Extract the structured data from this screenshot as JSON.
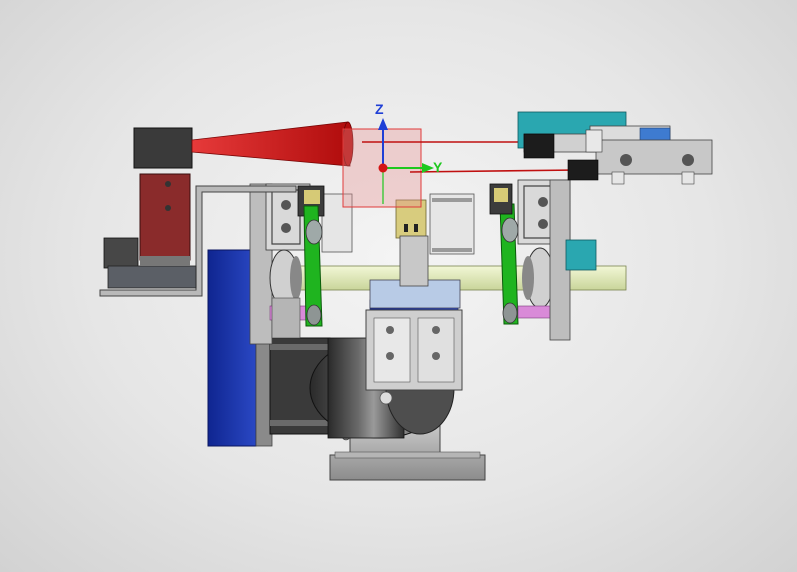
{
  "viewport": {
    "background_top": "#f4f4f4",
    "background_bottom": "#d2d2d2"
  },
  "triad": {
    "z_label": "Z",
    "y_label": "Y",
    "z_color": "#1f3fd6",
    "y_color": "#1ec81e",
    "x_color": "#d41414"
  },
  "colors": {
    "metal": "#9a9a9a",
    "metal_dark": "#5a5a5a",
    "bracket": "#b9b9b9",
    "laser_cone": "#c81414",
    "sensor_body": "#8a2b2b",
    "motor_blue": "#1c35a8",
    "rail": "#e3ecb8",
    "teal": "#2aa7b0",
    "belt_green": "#1fb41f",
    "pink_shaft": "#d98ad8",
    "tan_block": "#d8cc7e",
    "light_blue": "#8bb0e8"
  }
}
